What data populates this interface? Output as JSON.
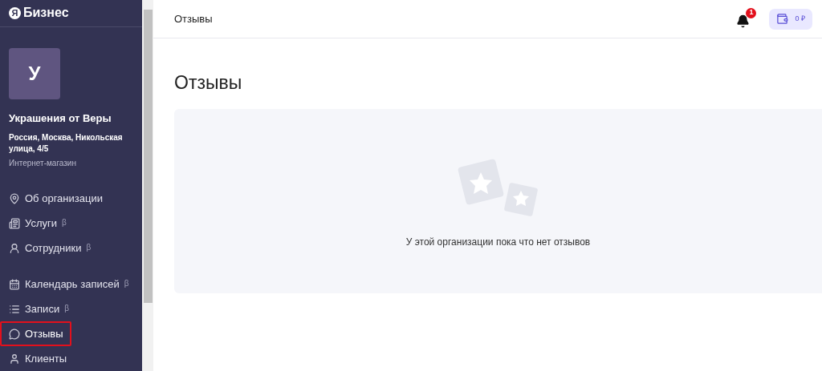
{
  "logo": {
    "mark": "Я",
    "text": "Бизнес"
  },
  "organization": {
    "avatar_letter": "У",
    "name": "Украшения от Веры",
    "address": "Россия, Москва, Никольская улица, 4/5",
    "category": "Интернет-магазин"
  },
  "nav_groups": [
    [
      {
        "label": "Об организации",
        "selected": false
      },
      {
        "label": "Услуги",
        "badge": "β",
        "selected": false
      },
      {
        "label": "Сотрудники",
        "badge": "β",
        "selected": false
      }
    ],
    [
      {
        "label": "Календарь записей",
        "badge": "β",
        "selected": false
      },
      {
        "label": "Записи",
        "badge": "β",
        "selected": false
      },
      {
        "label": "Отзывы",
        "selected": true
      },
      {
        "label": "Клиенты",
        "selected": false
      }
    ]
  ],
  "header": {
    "title": "Отзывы",
    "notifications": "1",
    "balance": "0 ₽"
  },
  "page": {
    "heading": "Отзывы",
    "empty_message": "У этой организации пока что нет отзывов"
  }
}
